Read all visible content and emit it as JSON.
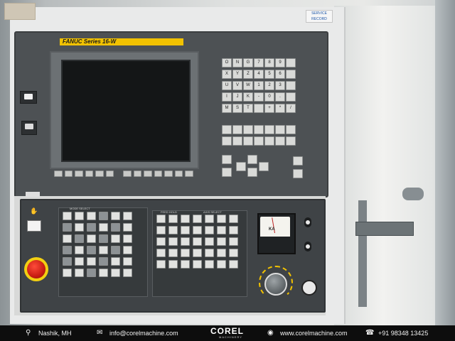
{
  "panel": {
    "brand_label": "FANUC Series 16-W",
    "service_sticker": "SERVICE RECORD",
    "meter_label": "KA",
    "keypad_main": [
      "O",
      "N",
      "G",
      "7",
      "8",
      "9",
      "",
      "X",
      "Y",
      "Z",
      "4",
      "5",
      "6",
      "",
      "U",
      "V",
      "W",
      "1",
      "2",
      "3",
      "",
      "I",
      "J",
      "K",
      "-",
      "0",
      ".",
      "",
      "M",
      "S",
      "T",
      "",
      "+",
      "*",
      "/"
    ],
    "mode_labels": {
      "left": "MODE SELECT",
      "mid": "FEED HOLD",
      "right": "AXIS SELECT"
    }
  },
  "footer": {
    "location": "Nashik, MH",
    "email": "info@corelmachine.com",
    "brand": "COREL",
    "brand_sub": "MACHINERY",
    "website": "www.corelmachine.com",
    "phone": "+91 98348 13425"
  },
  "icons": [
    "location-pin-icon",
    "email-icon",
    "globe-icon",
    "phone-icon"
  ],
  "colors": {
    "footer_bg": "#0d0d0d",
    "brand_strip": "#f2c200",
    "estop": "#d42a1c"
  }
}
